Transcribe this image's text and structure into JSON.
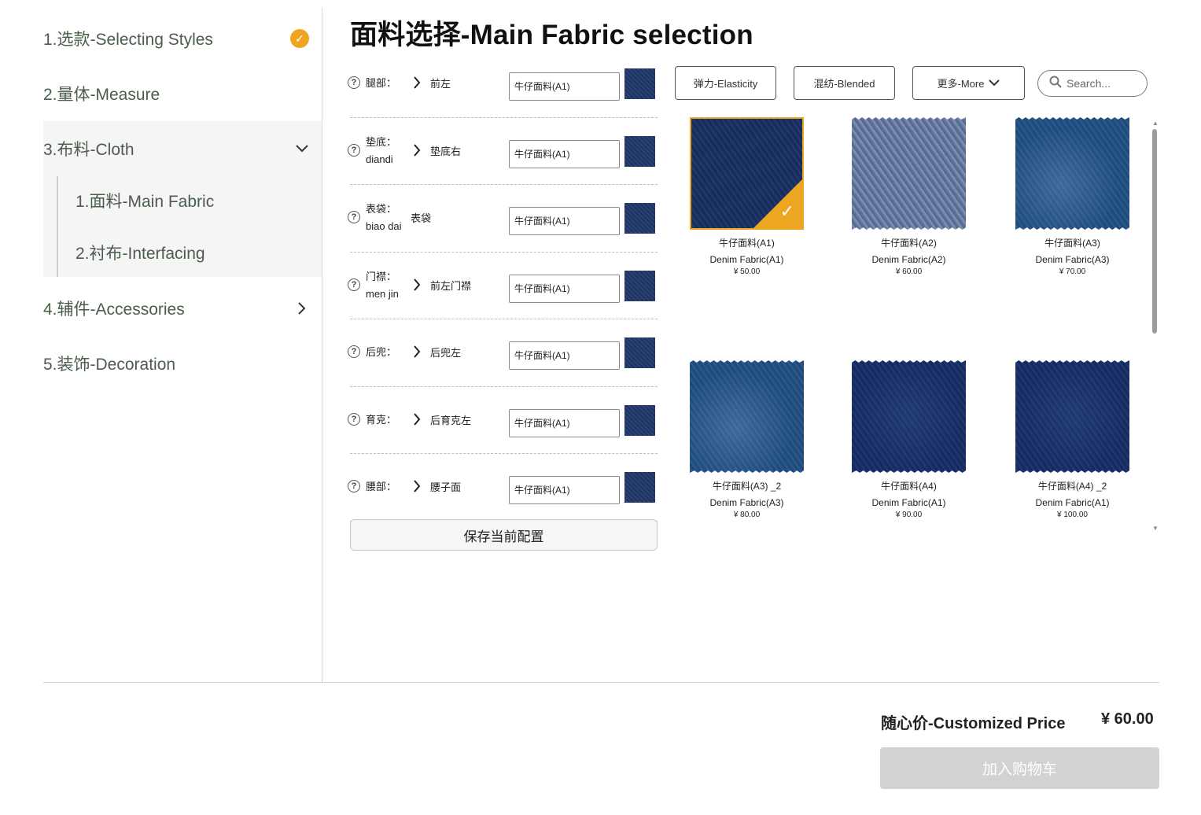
{
  "sidebar": {
    "steps": [
      {
        "label": "1.选款-Selecting Styles"
      },
      {
        "label": "2.量体-Measure"
      },
      {
        "label": "3.布料-Cloth"
      },
      {
        "label": "4.辅件-Accessories"
      },
      {
        "label": "5.装饰-Decoration"
      }
    ],
    "substeps": [
      {
        "label": "1.面料-Main Fabric"
      },
      {
        "label": "2.衬布-Interfacing"
      }
    ],
    "step1_status_icon": "check-icon",
    "step3_expand_icon": "chevron-down-icon",
    "step4_expand_icon": "chevron-right-icon"
  },
  "main": {
    "title": "面料选择-Main Fabric selection",
    "parts": [
      {
        "name": "腿部：",
        "name_en": "",
        "sub": "前左",
        "fabric": "牛仔面料(A1)"
      },
      {
        "name": "垫底：",
        "name_en": "diandi",
        "sub": "垫底右",
        "fabric": "牛仔面料(A1)"
      },
      {
        "name": "表袋：",
        "name_en": "biao dai",
        "sub": "表袋",
        "fabric": "牛仔面料(A1)"
      },
      {
        "name": "门襟：",
        "name_en": "men jin",
        "sub": "前左门襟",
        "fabric": "牛仔面料(A1)"
      },
      {
        "name": "后兜：",
        "name_en": "",
        "sub": "后兜左",
        "fabric": "牛仔面料(A1)"
      },
      {
        "name": "育克：",
        "name_en": "",
        "sub": "后育克左",
        "fabric": "牛仔面料(A1)"
      },
      {
        "name": "腰部：",
        "name_en": "",
        "sub": "腰子面",
        "fabric": "牛仔面料(A1)"
      }
    ],
    "save_label": "保存当前配置"
  },
  "filters": {
    "elasticity": "弹力-Elasticity",
    "blended": "混纺-Blended",
    "more": "更多-More",
    "search_placeholder": "Search..."
  },
  "fabrics": [
    {
      "cn": "牛仔面料(A1)",
      "en": "Denim Fabric(A1)",
      "price": "¥ 50.00",
      "selected": true
    },
    {
      "cn": "牛仔面料(A2)",
      "en": "Denim Fabric(A2)",
      "price": "¥ 60.00",
      "selected": false
    },
    {
      "cn": "牛仔面料(A3)",
      "en": "Denim Fabric(A3)",
      "price": "¥ 70.00",
      "selected": false
    },
    {
      "cn": "牛仔面料(A3) _2",
      "en": "Denim Fabric(A3)",
      "price": "¥ 80.00",
      "selected": false
    },
    {
      "cn": "牛仔面料(A4)",
      "en": "Denim Fabric(A1)",
      "price": "¥ 90.00",
      "selected": false
    },
    {
      "cn": "牛仔面料(A4) _2",
      "en": "Denim Fabric(A1)",
      "price": "¥ 100.00",
      "selected": false
    }
  ],
  "footer": {
    "price_label": "随心价-Customized Price",
    "price_value": "¥ 60.00",
    "cart_label": "加入购物车"
  },
  "colors": {
    "accent": "#eda522",
    "sidebar_text": "#4b5d4a",
    "cart_disabled": "#d2d2d2"
  }
}
